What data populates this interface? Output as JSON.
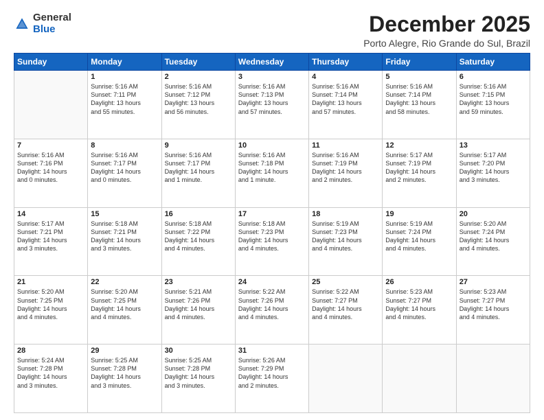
{
  "logo": {
    "line1": "General",
    "line2": "Blue"
  },
  "header": {
    "title": "December 2025",
    "subtitle": "Porto Alegre, Rio Grande do Sul, Brazil"
  },
  "weekdays": [
    "Sunday",
    "Monday",
    "Tuesday",
    "Wednesday",
    "Thursday",
    "Friday",
    "Saturday"
  ],
  "weeks": [
    [
      {
        "day": "",
        "info": ""
      },
      {
        "day": "1",
        "info": "Sunrise: 5:16 AM\nSunset: 7:11 PM\nDaylight: 13 hours\nand 55 minutes."
      },
      {
        "day": "2",
        "info": "Sunrise: 5:16 AM\nSunset: 7:12 PM\nDaylight: 13 hours\nand 56 minutes."
      },
      {
        "day": "3",
        "info": "Sunrise: 5:16 AM\nSunset: 7:13 PM\nDaylight: 13 hours\nand 57 minutes."
      },
      {
        "day": "4",
        "info": "Sunrise: 5:16 AM\nSunset: 7:14 PM\nDaylight: 13 hours\nand 57 minutes."
      },
      {
        "day": "5",
        "info": "Sunrise: 5:16 AM\nSunset: 7:14 PM\nDaylight: 13 hours\nand 58 minutes."
      },
      {
        "day": "6",
        "info": "Sunrise: 5:16 AM\nSunset: 7:15 PM\nDaylight: 13 hours\nand 59 minutes."
      }
    ],
    [
      {
        "day": "7",
        "info": "Sunrise: 5:16 AM\nSunset: 7:16 PM\nDaylight: 14 hours\nand 0 minutes."
      },
      {
        "day": "8",
        "info": "Sunrise: 5:16 AM\nSunset: 7:17 PM\nDaylight: 14 hours\nand 0 minutes."
      },
      {
        "day": "9",
        "info": "Sunrise: 5:16 AM\nSunset: 7:17 PM\nDaylight: 14 hours\nand 1 minute."
      },
      {
        "day": "10",
        "info": "Sunrise: 5:16 AM\nSunset: 7:18 PM\nDaylight: 14 hours\nand 1 minute."
      },
      {
        "day": "11",
        "info": "Sunrise: 5:16 AM\nSunset: 7:19 PM\nDaylight: 14 hours\nand 2 minutes."
      },
      {
        "day": "12",
        "info": "Sunrise: 5:17 AM\nSunset: 7:19 PM\nDaylight: 14 hours\nand 2 minutes."
      },
      {
        "day": "13",
        "info": "Sunrise: 5:17 AM\nSunset: 7:20 PM\nDaylight: 14 hours\nand 3 minutes."
      }
    ],
    [
      {
        "day": "14",
        "info": "Sunrise: 5:17 AM\nSunset: 7:21 PM\nDaylight: 14 hours\nand 3 minutes."
      },
      {
        "day": "15",
        "info": "Sunrise: 5:18 AM\nSunset: 7:21 PM\nDaylight: 14 hours\nand 3 minutes."
      },
      {
        "day": "16",
        "info": "Sunrise: 5:18 AM\nSunset: 7:22 PM\nDaylight: 14 hours\nand 4 minutes."
      },
      {
        "day": "17",
        "info": "Sunrise: 5:18 AM\nSunset: 7:23 PM\nDaylight: 14 hours\nand 4 minutes."
      },
      {
        "day": "18",
        "info": "Sunrise: 5:19 AM\nSunset: 7:23 PM\nDaylight: 14 hours\nand 4 minutes."
      },
      {
        "day": "19",
        "info": "Sunrise: 5:19 AM\nSunset: 7:24 PM\nDaylight: 14 hours\nand 4 minutes."
      },
      {
        "day": "20",
        "info": "Sunrise: 5:20 AM\nSunset: 7:24 PM\nDaylight: 14 hours\nand 4 minutes."
      }
    ],
    [
      {
        "day": "21",
        "info": "Sunrise: 5:20 AM\nSunset: 7:25 PM\nDaylight: 14 hours\nand 4 minutes."
      },
      {
        "day": "22",
        "info": "Sunrise: 5:20 AM\nSunset: 7:25 PM\nDaylight: 14 hours\nand 4 minutes."
      },
      {
        "day": "23",
        "info": "Sunrise: 5:21 AM\nSunset: 7:26 PM\nDaylight: 14 hours\nand 4 minutes."
      },
      {
        "day": "24",
        "info": "Sunrise: 5:22 AM\nSunset: 7:26 PM\nDaylight: 14 hours\nand 4 minutes."
      },
      {
        "day": "25",
        "info": "Sunrise: 5:22 AM\nSunset: 7:27 PM\nDaylight: 14 hours\nand 4 minutes."
      },
      {
        "day": "26",
        "info": "Sunrise: 5:23 AM\nSunset: 7:27 PM\nDaylight: 14 hours\nand 4 minutes."
      },
      {
        "day": "27",
        "info": "Sunrise: 5:23 AM\nSunset: 7:27 PM\nDaylight: 14 hours\nand 4 minutes."
      }
    ],
    [
      {
        "day": "28",
        "info": "Sunrise: 5:24 AM\nSunset: 7:28 PM\nDaylight: 14 hours\nand 3 minutes."
      },
      {
        "day": "29",
        "info": "Sunrise: 5:25 AM\nSunset: 7:28 PM\nDaylight: 14 hours\nand 3 minutes."
      },
      {
        "day": "30",
        "info": "Sunrise: 5:25 AM\nSunset: 7:28 PM\nDaylight: 14 hours\nand 3 minutes."
      },
      {
        "day": "31",
        "info": "Sunrise: 5:26 AM\nSunset: 7:29 PM\nDaylight: 14 hours\nand 2 minutes."
      },
      {
        "day": "",
        "info": ""
      },
      {
        "day": "",
        "info": ""
      },
      {
        "day": "",
        "info": ""
      }
    ]
  ]
}
